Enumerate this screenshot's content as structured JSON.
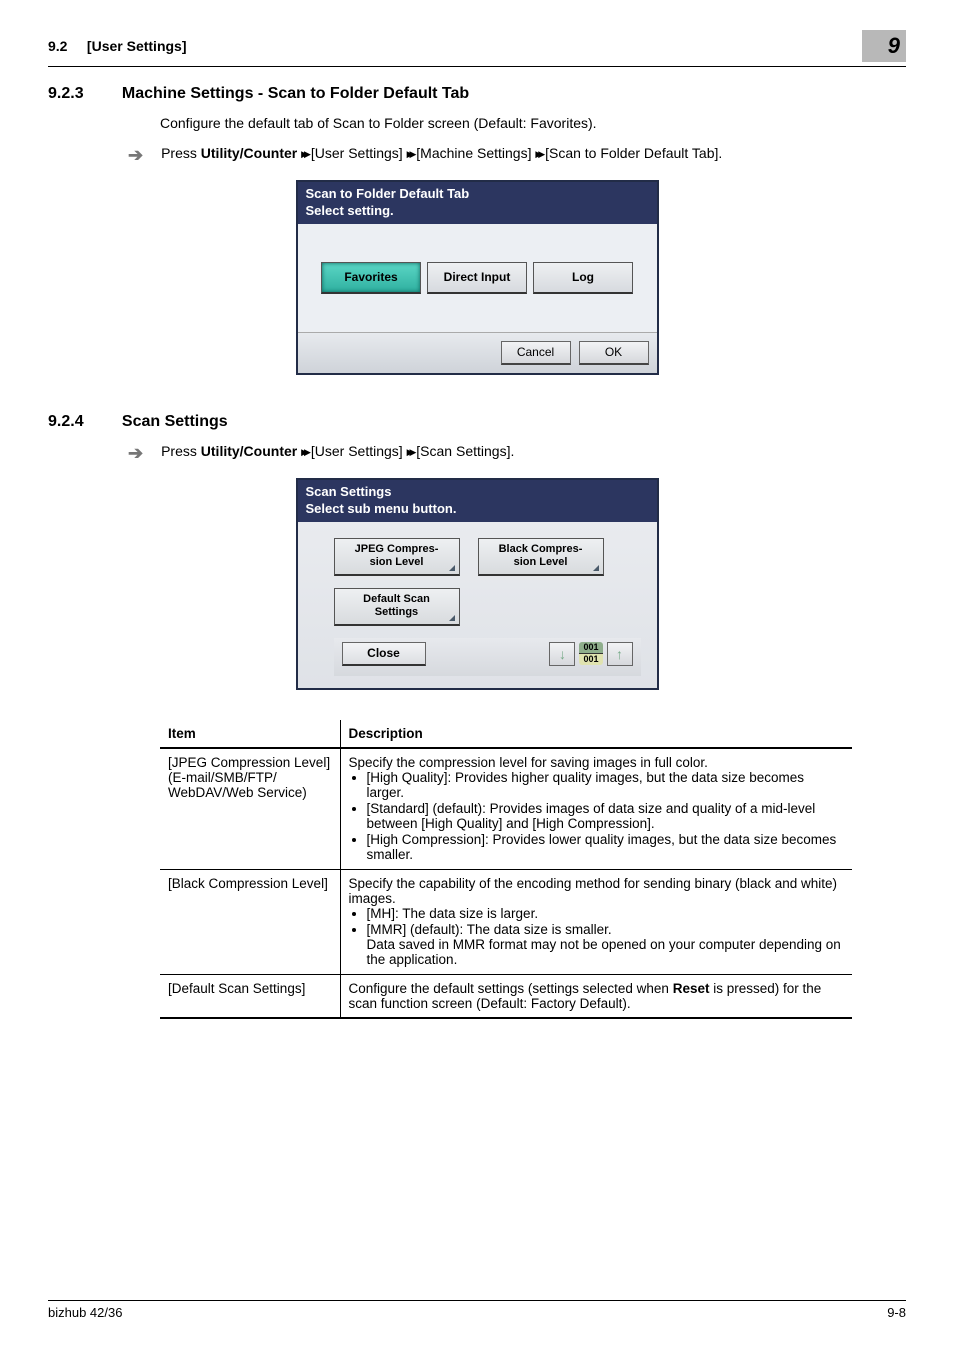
{
  "header": {
    "left_num": "9.2",
    "left_title": "[User Settings]",
    "right": "9"
  },
  "s1": {
    "num": "9.2.3",
    "title": "Machine Settings - Scan to Folder Default Tab",
    "intro": "Configure the default tab of Scan to Folder screen (Default: Favorites).",
    "press": "Press ",
    "press_b": "Utility/Counter",
    "press_tail": " [User Settings] ",
    "press_tail2": " [Machine Settings] ",
    "press_tail3": " [Scan to Folder Default Tab].",
    "panel": {
      "title_l1": "Scan to Folder Default Tab",
      "title_l2": "Select setting.",
      "opt_fav": "Favorites",
      "opt_dir": "Direct Input",
      "opt_log": "Log",
      "cancel": "Cancel",
      "ok": "OK"
    }
  },
  "s2": {
    "num": "9.2.4",
    "title": "Scan Settings",
    "press": "Press ",
    "press_b": "Utility/Counter",
    "press_tail": " [User Settings] ",
    "press_tail2": " [Scan Settings].",
    "panel": {
      "title_l1": "Scan Settings",
      "title_l2": "Select sub menu button.",
      "btn_jpeg": "JPEG Compres-\nsion Level",
      "btn_black": "Black Compres-\nsion Level",
      "btn_def": "Default Scan\nSettings",
      "close": "Close",
      "pg_top": "001",
      "pg_bot": "001"
    }
  },
  "table": {
    "h1": "Item",
    "h2": "Description",
    "r1c1": "[JPEG Compression Level] (E-mail/SMB/FTP/ WebDAV/Web Service)",
    "r1_intro": "Specify the compression level for saving images in full color.",
    "r1_b1": "[High Quality]: Provides higher quality images, but the data size becomes larger.",
    "r1_b2": "[Standard] (default): Provides images of data size and quality of a mid-level between [High Quality] and [High Compression].",
    "r1_b3": "[High Compression]: Provides lower quality images, but the data size becomes smaller.",
    "r2c1": "[Black Compression Level]",
    "r2_intro": "Specify the capability of the encoding method for sending binary (black and white) images.",
    "r2_b1": "[MH]: The data size is larger.",
    "r2_b2a": "[MMR] (default): The data size is smaller.",
    "r2_b2b": "Data saved in MMR format may not be opened on your computer depending on the application.",
    "r3c1": "[Default Scan Settings]",
    "r3_p1": "Configure the default settings (settings selected when ",
    "r3_b": "Reset",
    "r3_p2": " is pressed) for the scan function screen (Default: Factory Default)."
  },
  "footer": {
    "left": "bizhub 42/36",
    "right": "9-8"
  }
}
